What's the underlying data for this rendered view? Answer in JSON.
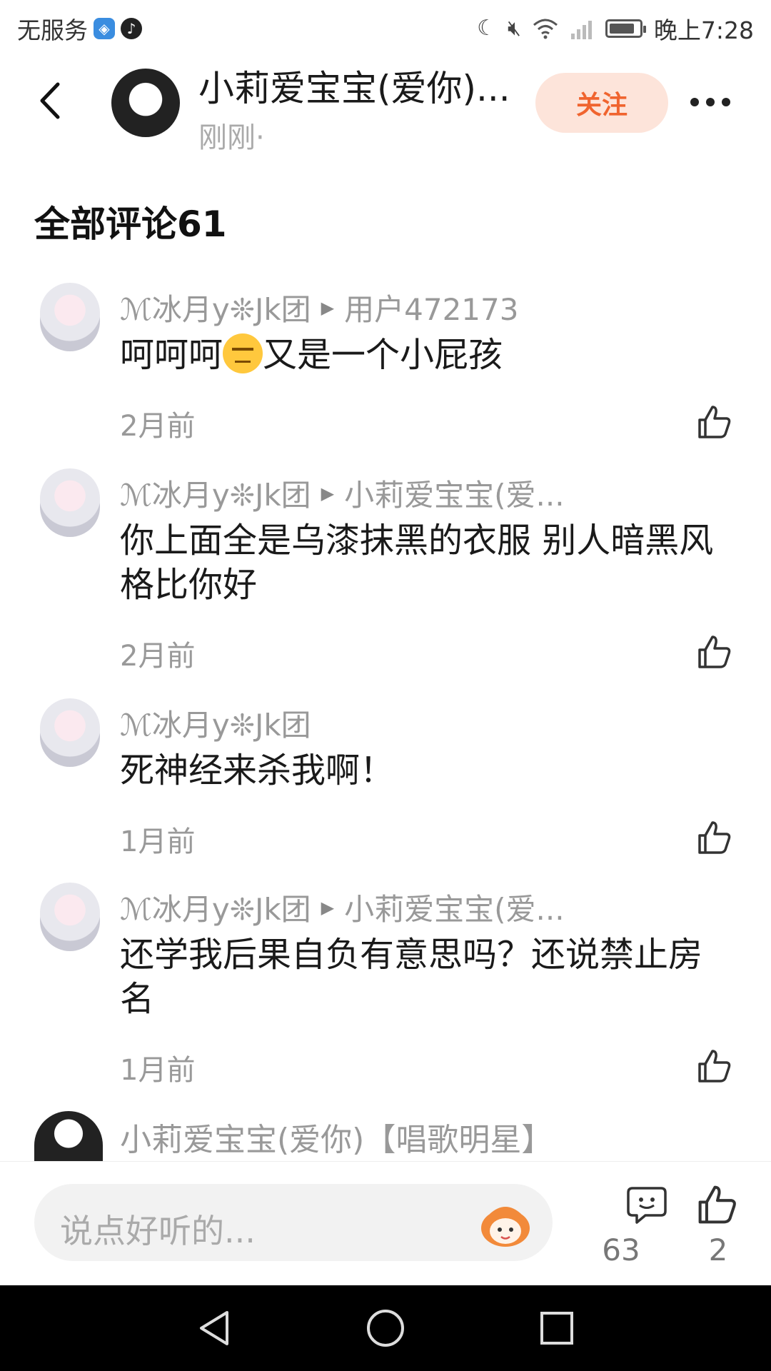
{
  "status_bar": {
    "carrier": "无服务",
    "time": "晚上7:28",
    "battery_level": 0.85
  },
  "header": {
    "name": "小莉爱宝宝(爱你)...",
    "subtitle": "刚刚·",
    "follow_label": "关注"
  },
  "comments_section": {
    "title": "全部评论61"
  },
  "comments": [
    {
      "author": "ℳ冰月y❊Jk团",
      "reply_to": "用户472173",
      "text_before": "呵呵呵",
      "emoji": "unamused-face",
      "text_after": "又是一个小屁孩",
      "time": "2月前"
    },
    {
      "author": "ℳ冰月y❊Jk团",
      "reply_to": "小莉爱宝宝(爱...",
      "text": "你上面全是乌漆抹黑的衣服  别人暗黑风格比你好",
      "time": "2月前"
    },
    {
      "author": "ℳ冰月y❊Jk团",
      "text": "死神经来杀我啊！",
      "time": "1月前"
    },
    {
      "author": "ℳ冰月y❊Jk团",
      "reply_to": "小莉爱宝宝(爱...",
      "text": "还学我后果自负有意思吗？还说禁止房名",
      "time": "1月前"
    }
  ],
  "partial_comment": {
    "author": "小莉爱宝宝(爱你)【唱歌明星】"
  },
  "bottom_bar": {
    "input_placeholder": "说点好听的...",
    "comment_count": "63",
    "like_count": "2"
  },
  "colors": {
    "follow_bg": "#fde4da",
    "follow_text": "#f0642f",
    "muted_text": "#999999"
  }
}
